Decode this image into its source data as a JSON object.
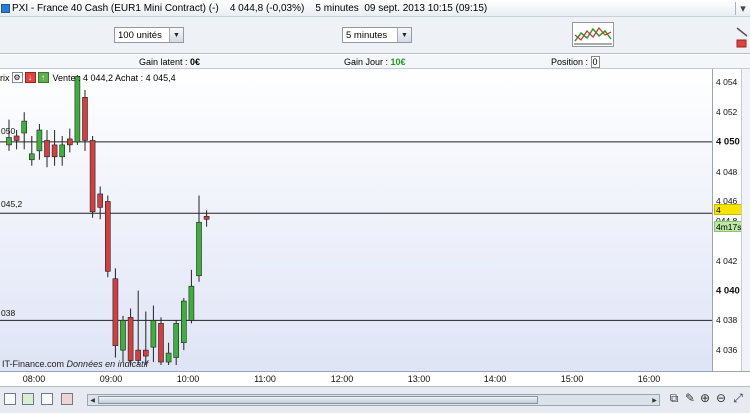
{
  "titlebar": {
    "title": "PXI - France 40 Cash (EUR1 Mini Contract) (-)    4 044,8 (-0,03%)    5 minutes  09 sept. 2013 10:15 (09:15)",
    "close": "▾"
  },
  "toolbar": {
    "quantity_select": "100 unités",
    "timeframe_select": "5 minutes"
  },
  "inforow": {
    "gain_latent_label": "Gain latent : ",
    "gain_latent_value": "0€",
    "gain_jour_label": "Gain Jour : ",
    "gain_jour_value": "10€",
    "position_label": "Position : ",
    "position_value": "0"
  },
  "order_bar": {
    "prefix": "rix",
    "vente_achat": "Vente : 4 044,2 Achat : 4 045,4"
  },
  "hlines": {
    "upper_label": "050",
    "middle_label": "045,2",
    "lower_label": "038"
  },
  "price_tags": {
    "last": "4 044,8",
    "timer": "4m17s"
  },
  "watermark": {
    "brand": "IT-Finance.com",
    "note": "Données en indicatif"
  },
  "chart_data": {
    "type": "candlestick",
    "y_ticks": [
      "4 054",
      "4 052",
      "4 050",
      "4 048",
      "4 046",
      "4 044,8",
      "4 042",
      "4 040",
      "4 038",
      "4 036"
    ],
    "x_ticks": [
      "08:00",
      "09:00",
      "10:00",
      "11:00",
      "12:00",
      "13:00",
      "14:00",
      "15:00",
      "16:00"
    ],
    "ylim": [
      4035.0,
      4054.5
    ],
    "reference_lines": [
      4050.0,
      4045.2,
      4038.0
    ],
    "candles": [
      {
        "t": 0,
        "o": 4049.8,
        "h": 4051.5,
        "l": 4049.4,
        "c": 4050.3
      },
      {
        "t": 1,
        "o": 4050.4,
        "h": 4050.8,
        "l": 4049.5,
        "c": 4050.1
      },
      {
        "t": 2,
        "o": 4050.6,
        "h": 4052.0,
        "l": 4049.5,
        "c": 4051.4
      },
      {
        "t": 3,
        "o": 4048.8,
        "h": 4050.4,
        "l": 4048.4,
        "c": 4049.2
      },
      {
        "t": 4,
        "o": 4049.4,
        "h": 4051.2,
        "l": 4048.8,
        "c": 4050.8
      },
      {
        "t": 5,
        "o": 4050.1,
        "h": 4050.8,
        "l": 4048.3,
        "c": 4049.0
      },
      {
        "t": 6,
        "o": 4049.8,
        "h": 4050.8,
        "l": 4048.4,
        "c": 4049.0
      },
      {
        "t": 7,
        "o": 4049.0,
        "h": 4050.4,
        "l": 4048.4,
        "c": 4049.8
      },
      {
        "t": 8,
        "o": 4050.2,
        "h": 4050.9,
        "l": 4049.3,
        "c": 4049.8
      },
      {
        "t": 9,
        "o": 4050.0,
        "h": 4054.5,
        "l": 4049.8,
        "c": 4054.4
      },
      {
        "t": 10,
        "o": 4053.0,
        "h": 4053.5,
        "l": 4049.4,
        "c": 4050.1
      },
      {
        "t": 11,
        "o": 4050.1,
        "h": 4050.4,
        "l": 4044.9,
        "c": 4045.3
      },
      {
        "t": 12,
        "o": 4046.5,
        "h": 4047.0,
        "l": 4044.8,
        "c": 4045.6
      },
      {
        "t": 13,
        "o": 4046.0,
        "h": 4046.4,
        "l": 4040.9,
        "c": 4041.3
      },
      {
        "t": 14,
        "o": 4040.8,
        "h": 4041.5,
        "l": 4035.5,
        "c": 4036.3
      },
      {
        "t": 15,
        "o": 4036.0,
        "h": 4038.3,
        "l": 4035.2,
        "c": 4038.0
      },
      {
        "t": 16,
        "o": 4038.2,
        "h": 4038.8,
        "l": 4035.0,
        "c": 4035.3
      },
      {
        "t": 17,
        "o": 4036.0,
        "h": 4040.0,
        "l": 4035.0,
        "c": 4035.3
      },
      {
        "t": 18,
        "o": 4036.0,
        "h": 4038.6,
        "l": 4035.0,
        "c": 4035.6
      },
      {
        "t": 19,
        "o": 4036.2,
        "h": 4039.0,
        "l": 4035.2,
        "c": 4038.0
      },
      {
        "t": 20,
        "o": 4037.8,
        "h": 4038.2,
        "l": 4035.0,
        "c": 4035.2
      },
      {
        "t": 21,
        "o": 4035.2,
        "h": 4036.5,
        "l": 4035.0,
        "c": 4035.8
      },
      {
        "t": 22,
        "o": 4035.5,
        "h": 4038.0,
        "l": 4035.0,
        "c": 4037.8
      },
      {
        "t": 23,
        "o": 4036.5,
        "h": 4039.5,
        "l": 4036.0,
        "c": 4039.3
      },
      {
        "t": 24,
        "o": 4038.0,
        "h": 4041.4,
        "l": 4037.8,
        "c": 4040.3
      },
      {
        "t": 25,
        "o": 4041.0,
        "h": 4046.4,
        "l": 4040.6,
        "c": 4044.6
      },
      {
        "t": 26,
        "o": 4045.0,
        "h": 4045.4,
        "l": 4044.3,
        "c": 4044.8
      }
    ]
  }
}
